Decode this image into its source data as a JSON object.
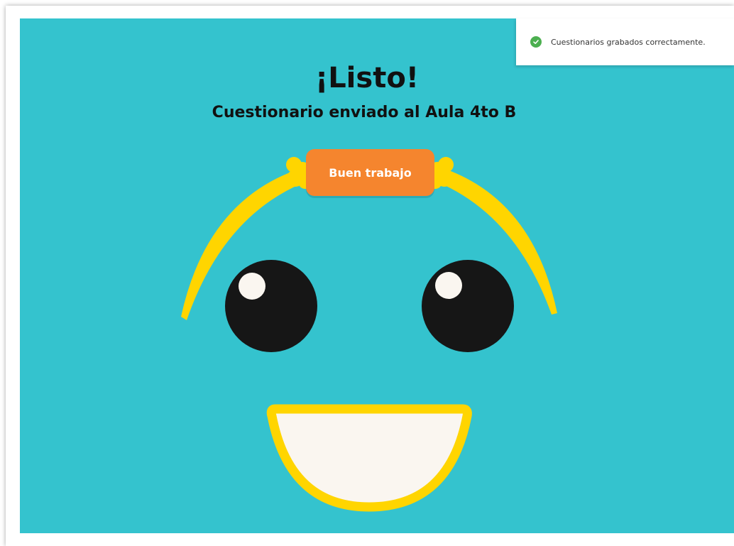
{
  "notification": {
    "message": "Cuestionarios grabados correctamente.",
    "icon": "check-circle-icon",
    "icon_color": "#4caf50"
  },
  "header": {
    "title": "¡Listo!",
    "subtitle": "Cuestionario enviado al Aula 4to B"
  },
  "badge": {
    "label": "Buen trabajo",
    "color": "#f5852e"
  },
  "colors": {
    "background": "#34c3ce",
    "accent_yellow": "#ffd500",
    "eye": "#161616",
    "eye_highlight": "#faf6f0",
    "mouth": "#faf6f0"
  }
}
